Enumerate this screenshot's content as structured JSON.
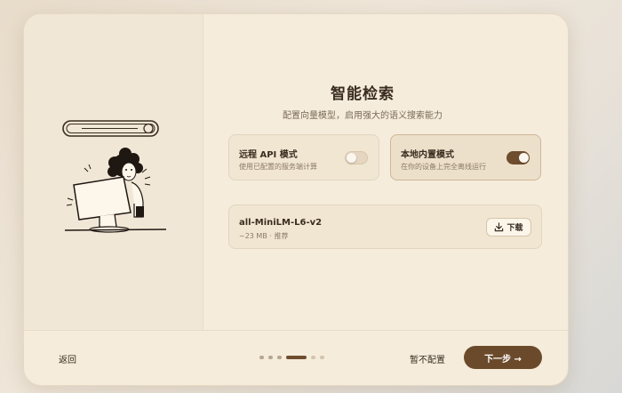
{
  "page": {
    "title": "智能检索",
    "subtitle": "配置向量模型，启用强大的语义搜索能力"
  },
  "modes": [
    {
      "title": "远程 API 模式",
      "desc": "使用已配置的服务端计算",
      "enabled": false
    },
    {
      "title": "本地内置模式",
      "desc": "在你的设备上完全离线运行",
      "enabled": true
    }
  ],
  "model": {
    "name": "all-MiniLM-L6-v2",
    "meta": "~23 MB · 推荐",
    "download_label": "下载",
    "download_icon": "download-icon"
  },
  "footer": {
    "back_label": "返回",
    "skip_label": "暂不配置",
    "next_label": "下一步 →",
    "steps_total": 6,
    "step_current": 4
  },
  "colors": {
    "accent": "#6b4a2b",
    "card_bg": "#f5ecdc"
  }
}
